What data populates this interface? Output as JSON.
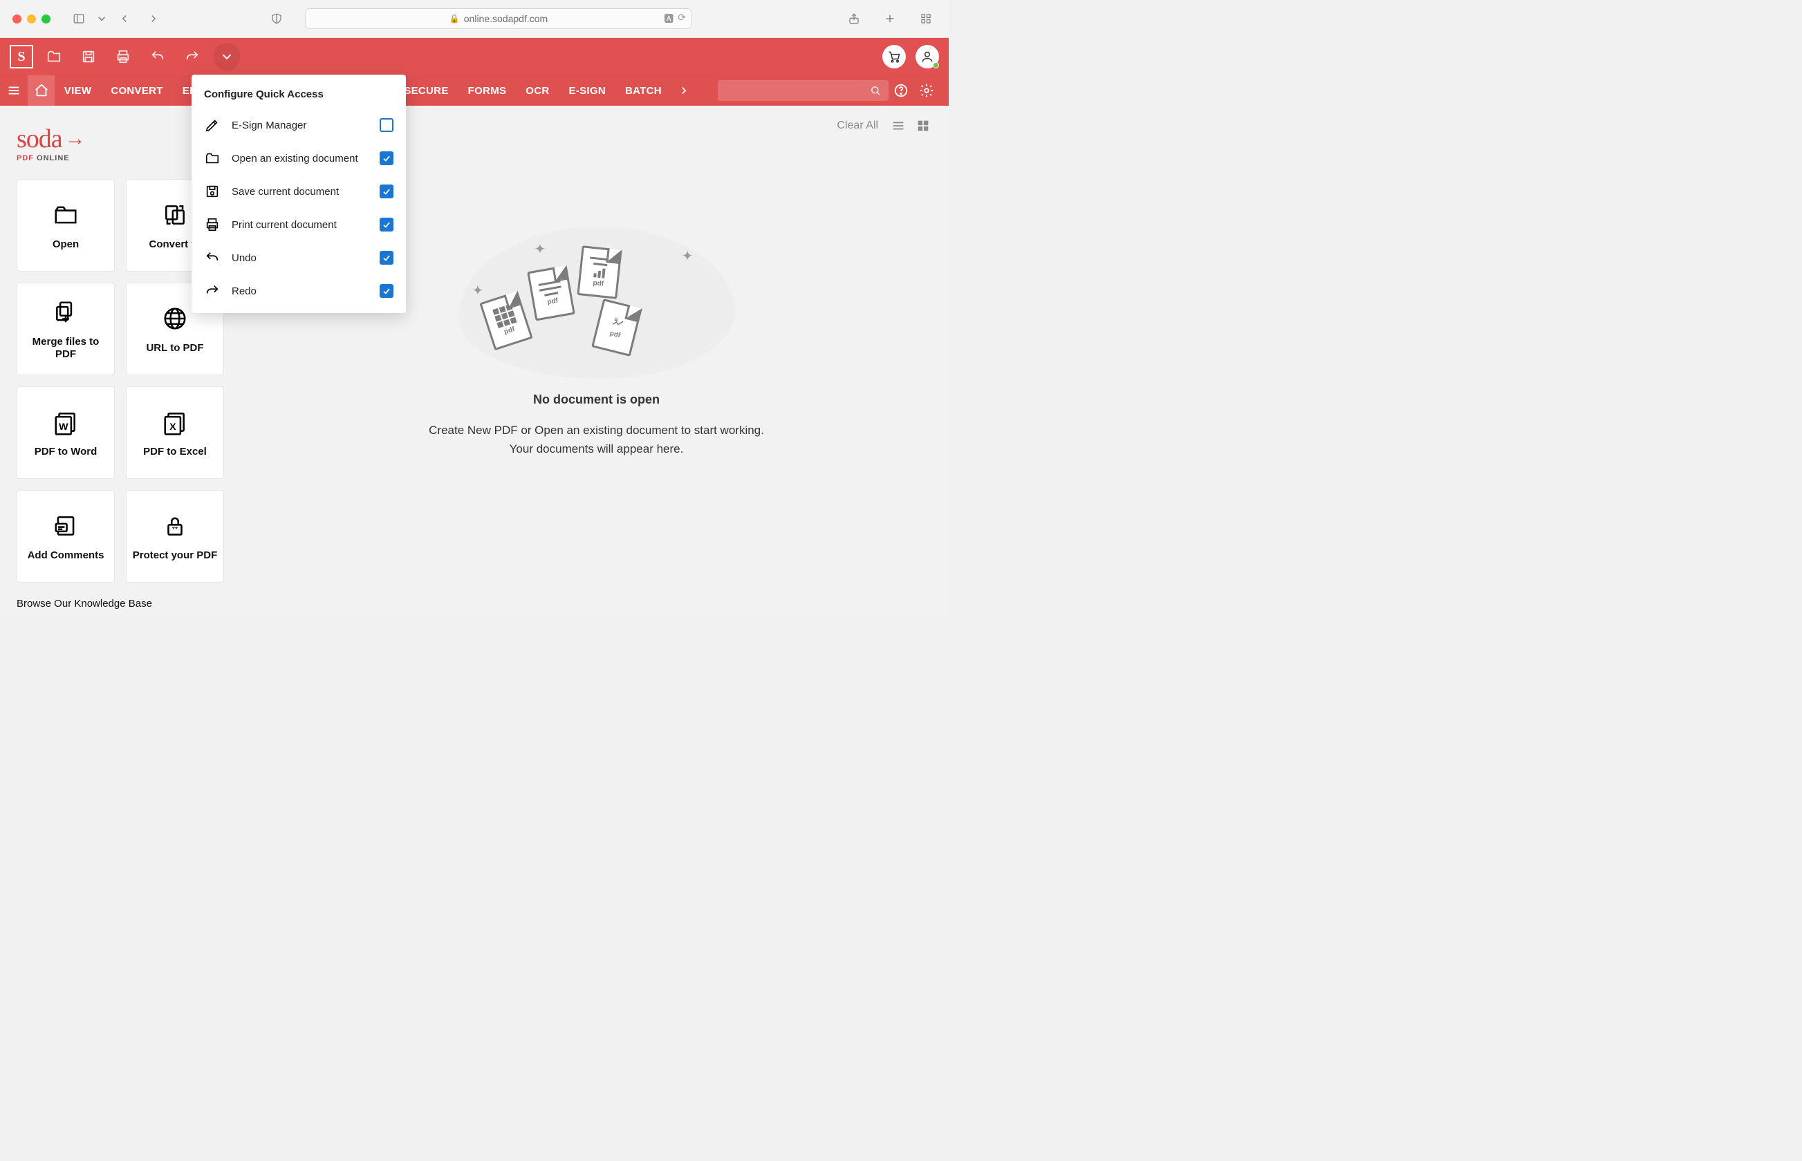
{
  "browser": {
    "url": "online.sodapdf.com"
  },
  "ribbon_tabs": [
    "VIEW",
    "CONVERT",
    "ED",
    "SECURE",
    "FORMS",
    "OCR",
    "E-SIGN",
    "BATCH"
  ],
  "right_header": {
    "clear_all": "Clear All"
  },
  "logo": {
    "word": "soda",
    "sub_red": "PDF",
    "sub_rest": " ONLINE"
  },
  "tiles": [
    {
      "label": "Open",
      "icon": "folder-open"
    },
    {
      "label": "Convert to",
      "icon": "convert"
    },
    {
      "label": "Merge files to PDF",
      "icon": "merge"
    },
    {
      "label": "URL to PDF",
      "icon": "globe"
    },
    {
      "label": "PDF to Word",
      "icon": "word"
    },
    {
      "label": "PDF to Excel",
      "icon": "excel"
    },
    {
      "label": "Add Comments",
      "icon": "comment"
    },
    {
      "label": "Protect your PDF",
      "icon": "lock"
    }
  ],
  "kb_link": "Browse Our Knowledge Base",
  "empty_state": {
    "title": "No document is open",
    "line1": "Create New PDF or Open an existing document to start working.",
    "line2": "Your documents will appear here."
  },
  "popover": {
    "title": "Configure Quick Access",
    "items": [
      {
        "label": "E-Sign Manager",
        "checked": false,
        "icon": "pen"
      },
      {
        "label": "Open an existing document",
        "checked": true,
        "icon": "folder-open"
      },
      {
        "label": "Save current document",
        "checked": true,
        "icon": "save"
      },
      {
        "label": "Print current document",
        "checked": true,
        "icon": "print"
      },
      {
        "label": "Undo",
        "checked": true,
        "icon": "undo"
      },
      {
        "label": "Redo",
        "checked": true,
        "icon": "redo"
      }
    ]
  }
}
